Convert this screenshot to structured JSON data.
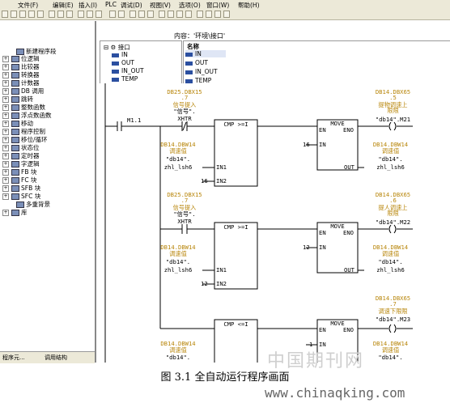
{
  "menu": {
    "items": [
      "文件(F)",
      "编辑(E)",
      "插入(I)",
      "PLC",
      "调试(D)",
      "视图(V)",
      "选项(O)",
      "窗口(W)",
      "帮助(H)"
    ]
  },
  "tree": {
    "items": [
      "新建程序段",
      "位逻辑",
      "比较器",
      "转换器",
      "计数器",
      "DB 调用",
      "跳转",
      "整数函数",
      "浮点数函数",
      "移动",
      "程序控制",
      "移位/循环",
      "状态位",
      "定时器",
      "字逻辑",
      "FB 块",
      "FC 块",
      "SFB 块",
      "SFC 块",
      "多重背景",
      "库"
    ],
    "tabs": [
      "程序元...",
      "调用结构"
    ]
  },
  "interface": {
    "header": "内容：'环境\\接口'",
    "root": "接口",
    "left_items": [
      "IN",
      "OUT",
      "IN_OUT",
      "TEMP"
    ],
    "name_header": "名称",
    "right_items": [
      "IN",
      "OUT",
      "IN_OUT",
      "TEMP"
    ]
  },
  "ladder": {
    "net1": {
      "contact_addr": "M1.1",
      "xhtr_addr": [
        "DB25.DBX15",
        ".7"
      ],
      "xhtr_comment": "信号提入",
      "xhtr_sym": "\"信号\".",
      "xhtr_name": "XHTR",
      "cmp_label": "CMP >=I",
      "in1_addr": "DB14.DBW14",
      "in1_comment": "调速值",
      "in1_sym": "\"db14\".",
      "in1_name": "zhl_lsh6",
      "in1_pin": "IN1",
      "in2_val": "16",
      "in2_pin": "IN2",
      "move_label": "MOVE",
      "en": "EN",
      "eno": "ENO",
      "move_in_val": "16",
      "move_in_pin": "IN",
      "move_out_pin": "OUT",
      "out_addr": "DB14.DBW14",
      "out_comment": "调速值",
      "out_sym": "\"db14\".",
      "out_name": "zhl_lsh6",
      "coil_addr": [
        "DB14.DBX65",
        ".5"
      ],
      "coil_comment": [
        "提物调速上",
        "限限"
      ],
      "coil_sym": "\"db14\".M21"
    },
    "net2": {
      "xhtr_addr": [
        "DB25.DBX15",
        ".7"
      ],
      "xhtr_comment": "信号提入",
      "xhtr_sym": "\"信号\".",
      "xhtr_name": "XHTR",
      "cmp_label": "CMP >=I",
      "in1_addr": "DB14.DBW14",
      "in1_comment": "调速值",
      "in1_sym": "\"db14\".",
      "in1_name": "zhl_lsh6",
      "in1_pin": "IN1",
      "in2_val": "12",
      "in2_pin": "IN2",
      "move_label": "MOVE",
      "en": "EN",
      "eno": "ENO",
      "move_in_val": "12",
      "move_in_pin": "IN",
      "move_out_pin": "OUT",
      "out_addr": "DB14.DBW14",
      "out_comment": "调速值",
      "out_sym": "\"db14\".",
      "out_name": "zhl_lsh6",
      "coil_addr": [
        "DB14.DBX65",
        ".6"
      ],
      "coil_comment": [
        "提人调速上",
        "限限"
      ],
      "coil_sym": "\"db14\".M22"
    },
    "net3": {
      "cmp_label": "CMP <=I",
      "in1_addr": "DB14.DBW14",
      "in1_comment": "调速值",
      "in1_sym": "\"db14\".",
      "move_label": "MOVE",
      "en": "EN",
      "eno": "ENO",
      "move_in_val": "1",
      "move_in_pin": "IN",
      "out_addr": "DB14.DBW14",
      "out_comment": "调速值",
      "out_sym": "\"db14\".",
      "coil_addr": [
        "DB14.DBX65",
        ".7"
      ],
      "coil_comment": [
        "调速下限限"
      ],
      "coil_sym": "\"db14\".M23"
    }
  },
  "caption": "图 3.1 全自动运行程序画面",
  "watermark": {
    "cn": "中国期刊网",
    "url": "www.chinaqking.com"
  }
}
